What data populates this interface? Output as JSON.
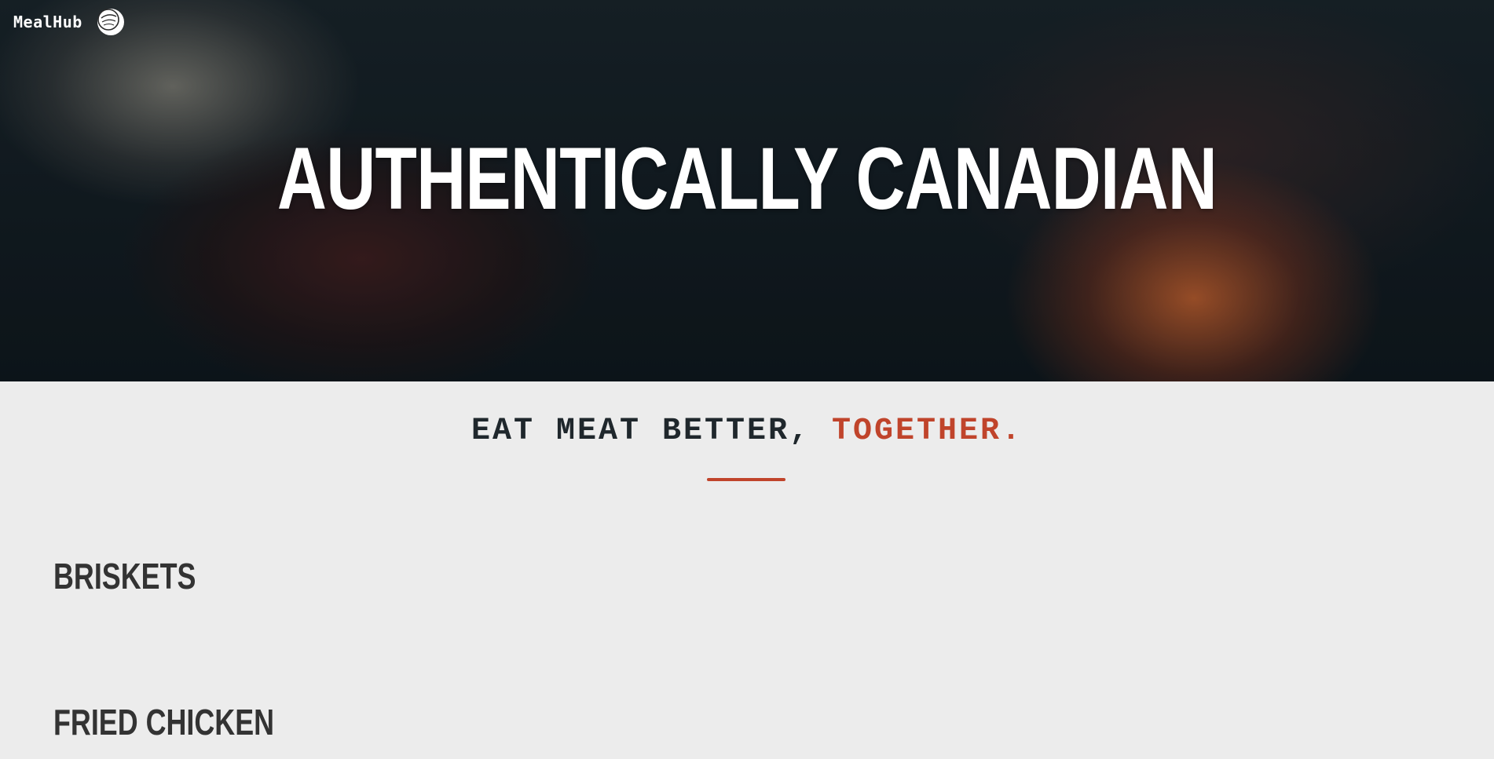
{
  "brand": {
    "name": "MealHub",
    "logo_icon": "meat-badge-icon"
  },
  "hero": {
    "title": "AUTHENTICALLY CANADIAN"
  },
  "tagline": {
    "text_main": "EAT MEAT BETTER,",
    "text_accent": "TOGETHER."
  },
  "sections": [
    {
      "title": "BRISKETS"
    },
    {
      "title": "FRIED CHICKEN"
    }
  ],
  "colors": {
    "accent": "#c0442b",
    "text_dark": "#1f272c",
    "heading": "#333333",
    "page_bg": "#ececec",
    "hero_text": "#ffffff"
  }
}
